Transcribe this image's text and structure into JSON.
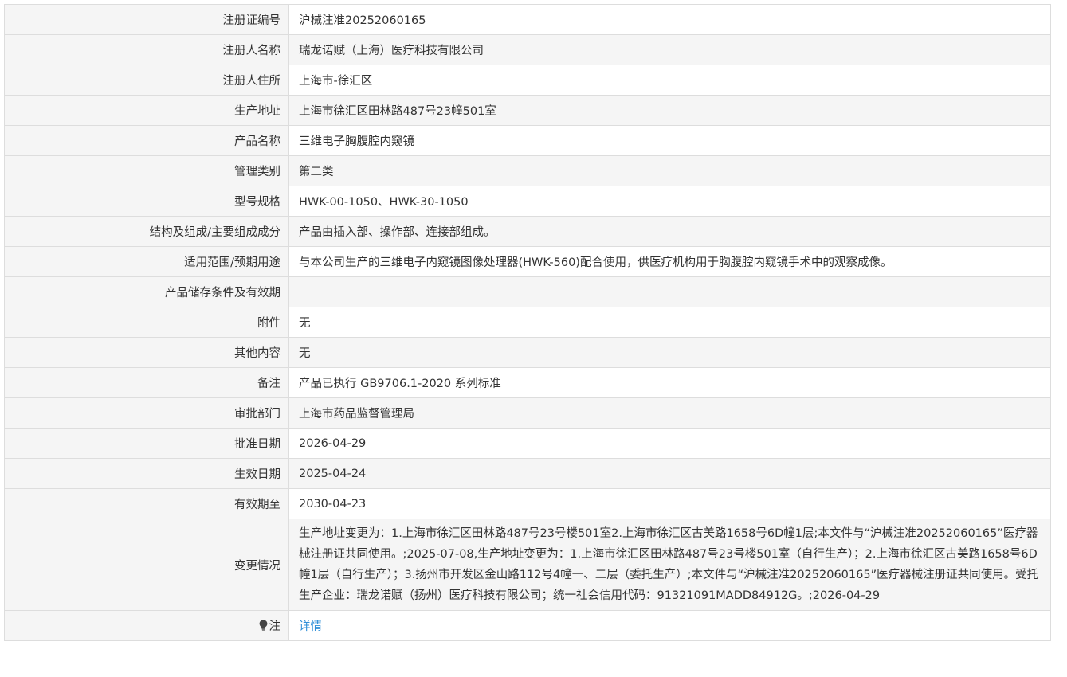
{
  "rows": [
    {
      "label": "注册证编号",
      "value": "沪械注准20252060165"
    },
    {
      "label": "注册人名称",
      "value": "瑞龙诺赋（上海）医疗科技有限公司"
    },
    {
      "label": "注册人住所",
      "value": "上海市-徐汇区"
    },
    {
      "label": "生产地址",
      "value": "上海市徐汇区田林路487号23幢501室"
    },
    {
      "label": "产品名称",
      "value": "三维电子胸腹腔内窥镜"
    },
    {
      "label": "管理类别",
      "value": "第二类"
    },
    {
      "label": "型号规格",
      "value": "HWK-00-1050、HWK-30-1050"
    },
    {
      "label": "结构及组成/主要组成成分",
      "value": "产品由插入部、操作部、连接部组成。"
    },
    {
      "label": "适用范围/预期用途",
      "value": "与本公司生产的三维电子内窥镜图像处理器(HWK-560)配合使用，供医疗机构用于胸腹腔内窥镜手术中的观察成像。"
    },
    {
      "label": "产品储存条件及有效期",
      "value": ""
    },
    {
      "label": "附件",
      "value": "无"
    },
    {
      "label": "其他内容",
      "value": "无"
    },
    {
      "label": "备注",
      "value": "产品已执行 GB9706.1-2020 系列标准"
    },
    {
      "label": "审批部门",
      "value": "上海市药品监督管理局"
    },
    {
      "label": "批准日期",
      "value": "2026-04-29"
    },
    {
      "label": "生效日期",
      "value": "2025-04-24"
    },
    {
      "label": "有效期至",
      "value": "2030-04-23"
    },
    {
      "label": "变更情况",
      "value": "生产地址变更为：1.上海市徐汇区田林路487号23号楼501室2.上海市徐汇区古美路1658号6D幢1层;本文件与“沪械注准20252060165”医疗器械注册证共同使用。;2025-07-08,生产地址变更为：1.上海市徐汇区田林路487号23号楼501室（自行生产）；2.上海市徐汇区古美路1658号6D幢1层（自行生产）；3.扬州市开发区金山路112号4幢一、二层（委托生产）;本文件与“沪械注准20252060165”医疗器械注册证共同使用。受托生产企业：瑞龙诺赋（扬州）医疗科技有限公司；统一社会信用代码：91321091MADD84912G。;2026-04-29"
    }
  ],
  "note": {
    "label": "注",
    "icon": "lightbulb-icon",
    "link_text": "详情",
    "link_color": "#2f8fd8"
  }
}
